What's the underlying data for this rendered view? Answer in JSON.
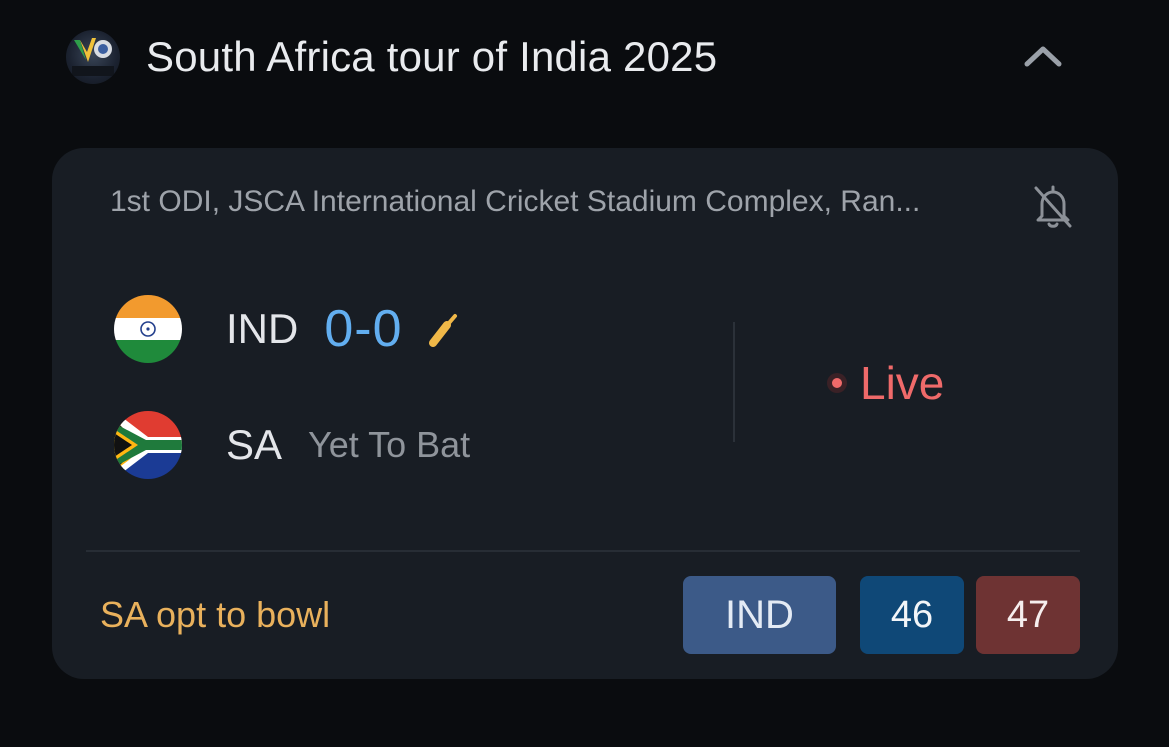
{
  "header": {
    "series_logo_text": "SA v IND",
    "series_title": "South Africa tour of India 2025",
    "collapse_icon": "chevron-up-icon"
  },
  "match": {
    "info": "1st ODI, JSCA International Cricket Stadium Complex, Ran...",
    "notification_icon": "bell-off-icon",
    "teams": [
      {
        "name": "IND",
        "score": "0-0",
        "batting": true,
        "flag": "india-flag"
      },
      {
        "name": "SA",
        "status": "Yet To Bat",
        "batting": false,
        "flag": "south-africa-flag"
      }
    ],
    "state": "Live",
    "toss": "SA opt to bowl",
    "odds": {
      "team": "IND",
      "back": "46",
      "lay": "47"
    }
  },
  "colors": {
    "background": "#0a0c0f",
    "card": "#181d24",
    "score": "#62aef0",
    "live": "#ef6a6a",
    "toss": "#e9b15c",
    "bat_icon": "#f0b848",
    "chip_team": "#3c5a88",
    "chip_back": "#0f4877",
    "chip_lay": "#6e3333"
  }
}
